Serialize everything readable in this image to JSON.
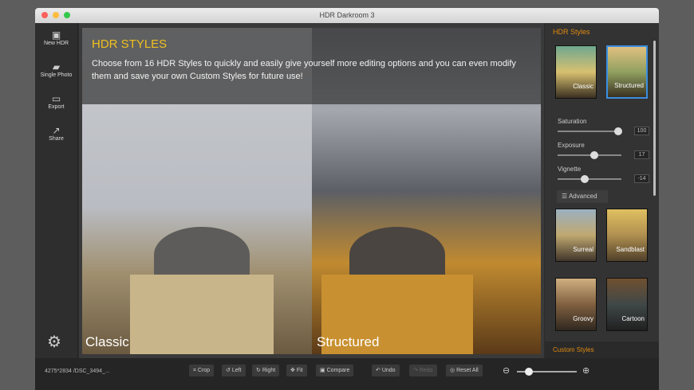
{
  "window": {
    "title": "HDR Darkroom 3"
  },
  "sidebar": {
    "items": [
      {
        "label": "New HDR",
        "icon": "image-icon"
      },
      {
        "label": "Single Photo",
        "icon": "folder-icon"
      },
      {
        "label": "Export",
        "icon": "export-icon"
      },
      {
        "label": "Share",
        "icon": "share-icon"
      }
    ],
    "settings_icon": "gear-icon"
  },
  "banner": {
    "title": "HDR STYLES",
    "text": "Choose from 16 HDR Styles to quickly and easily give yourself more editing options and you can even modify them and save your own Custom Styles for future use!"
  },
  "compare": {
    "left_label": "Classic",
    "right_label": "Structured"
  },
  "panel": {
    "title": "HDR Styles",
    "styles": [
      {
        "label": "Classic"
      },
      {
        "label": "Structured",
        "selected": true
      },
      {
        "label": "Surreal"
      },
      {
        "label": "Sandblast"
      },
      {
        "label": "Groovy"
      },
      {
        "label": "Cartoon"
      }
    ],
    "sliders": [
      {
        "label": "Saturation",
        "value": "100",
        "level": 0.95
      },
      {
        "label": "Exposure",
        "value": "17",
        "level": 0.58
      },
      {
        "label": "Vignette",
        "value": "-14",
        "level": 0.43
      }
    ],
    "advanced_label": "Advanced",
    "custom_styles": "Custom Styles",
    "accent": "#e08a10"
  },
  "toolbar": {
    "file_info": "4275*2834 /DSC_3494_...",
    "crop": "Crop",
    "left": "Left",
    "right": "Right",
    "fit": "Fit",
    "compare": "Compare",
    "undo": "Undo",
    "redo": "Redo",
    "reset": "Reset All",
    "zoom_level": 0.2
  }
}
